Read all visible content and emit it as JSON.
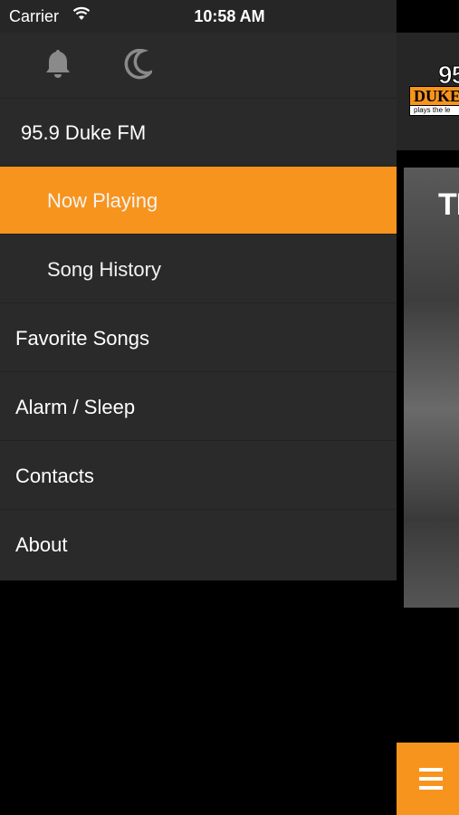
{
  "status_bar": {
    "carrier": "Carrier",
    "time": "10:58 AM"
  },
  "drawer": {
    "top_icons": [
      "bell-icon",
      "moon-icon"
    ],
    "station": "95.9 Duke FM",
    "sub_items": [
      {
        "label": "Now Playing",
        "active": true
      },
      {
        "label": "Song History",
        "active": false
      }
    ],
    "items": [
      {
        "label": "Favorite Songs"
      },
      {
        "label": "Alarm / Sleep"
      },
      {
        "label": "Contacts"
      },
      {
        "label": "About"
      }
    ]
  },
  "main": {
    "logo": {
      "number": "95",
      "name": "DUKE",
      "tagline": "plays the le"
    },
    "album_text": "TI",
    "menu_icon": "hamburger-icon"
  },
  "colors": {
    "accent": "#f7941d",
    "drawer_bg": "#2a2a2a",
    "header_bg": "#262626"
  }
}
